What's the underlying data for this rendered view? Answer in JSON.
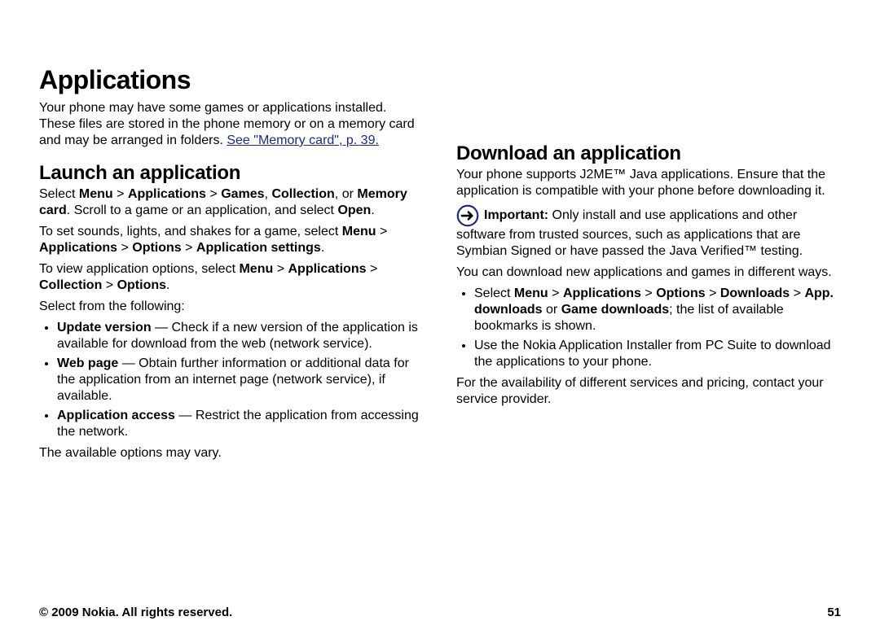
{
  "header": {
    "title": "Applications"
  },
  "left": {
    "intro_1": "Your phone may have some games or applications installed. These files are stored in the phone memory or on a memory card and may be arranged in folders. ",
    "intro_link": "See \"Memory card\", p. 39.",
    "section_title": "Launch an application",
    "p1_a": "Select ",
    "p1_b": "Menu",
    "p1_c": " > ",
    "p1_d": "Applications",
    "p1_e": " > ",
    "p1_f": "Games",
    "p1_g": ", ",
    "p1_h": "Collection",
    "p1_i": ", or ",
    "p1_j": "Memory card",
    "p1_k": ". Scroll to a game or an application, and select ",
    "p1_l": "Open",
    "p1_m": ".",
    "p2_a": "To set sounds, lights, and shakes for a game, select ",
    "p2_b": "Menu",
    "p2_c": " > ",
    "p2_d": "Applications",
    "p2_e": " > ",
    "p2_f": "Options",
    "p2_g": " > ",
    "p2_h": "Application settings",
    "p2_i": ".",
    "p3_a": "To view application options, select ",
    "p3_b": "Menu",
    "p3_c": " > ",
    "p3_d": "Applications",
    "p3_e": " > ",
    "p3_f": "Collection",
    "p3_g": " > ",
    "p3_h": "Options",
    "p3_i": ".",
    "p4": "Select from the following:",
    "bullets": [
      {
        "title": "Update version",
        "text": " — Check if a new version of the application is available for download from the web (network service)."
      },
      {
        "title": "Web page",
        "text": " — Obtain further information or additional data for the application from an internet page (network service), if available."
      },
      {
        "title": "Application access",
        "text": " — Restrict the application from accessing the network."
      }
    ],
    "p5": "The available options may vary."
  },
  "right": {
    "section_title": "Download an application",
    "p1": "Your phone supports J2ME™ Java applications. Ensure that the application is compatible with your phone before downloading it.",
    "important_label": "Important:",
    "important_text": " Only install and use applications and other software from trusted sources, such as applications that are Symbian Signed or have passed the Java Verified™ testing.",
    "p2": "You can download new applications and games in different ways.",
    "b1_a": "Select ",
    "b1_b": "Menu",
    "b1_c": " > ",
    "b1_d": "Applications",
    "b1_e": " > ",
    "b1_f": "Options",
    "b1_g": " > ",
    "b1_h": "Downloads",
    "b1_i": " > ",
    "b1_j": "App. downloads",
    "b1_k": " or ",
    "b1_l": "Game downloads",
    "b1_m": "; the list of available bookmarks is shown.",
    "b2": "Use the Nokia Application Installer from PC Suite to download the applications to your phone.",
    "p3": "For the availability of different services and pricing, contact your service provider."
  },
  "footer": {
    "copyright": "© 2009 Nokia. All rights reserved.",
    "page_number": "51"
  }
}
